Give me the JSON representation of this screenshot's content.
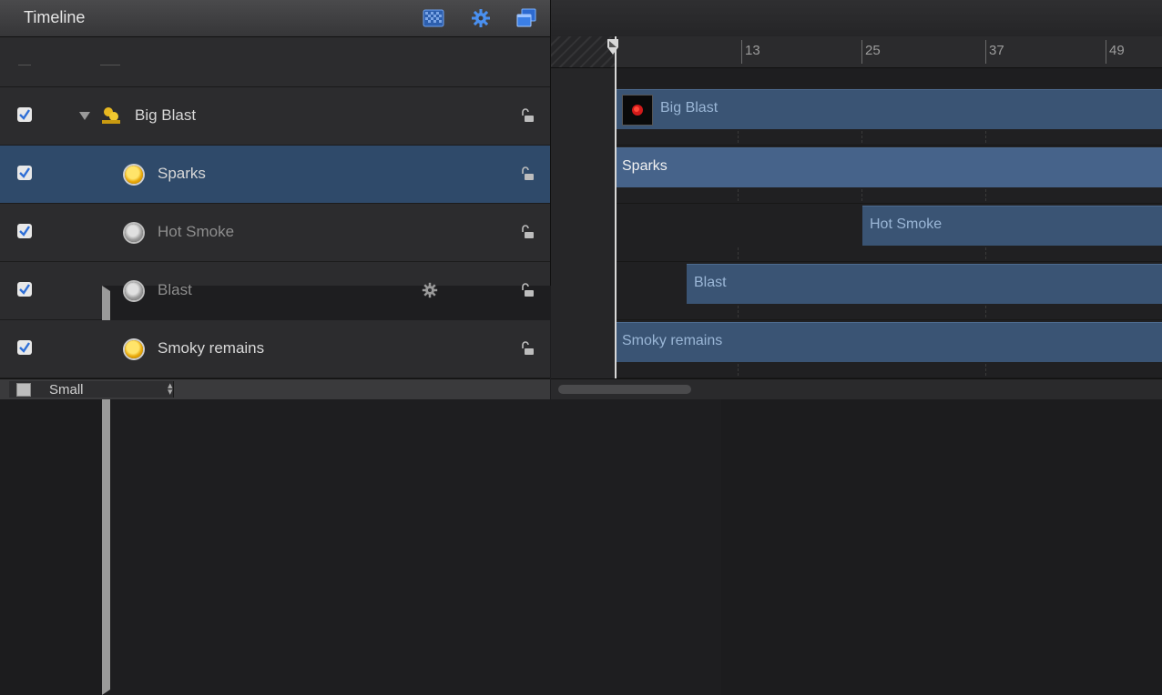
{
  "header": {
    "title": "Timeline",
    "icons": [
      "checker-grid-icon",
      "gear-icon",
      "stacked-windows-icon"
    ],
    "accent": "#3a7ee0"
  },
  "layers": [
    {
      "name": "Big Blast",
      "type": "group",
      "checked": true,
      "expanded": true,
      "dim": false,
      "selected": false
    },
    {
      "name": "Sparks",
      "type": "emitter",
      "checked": true,
      "dim": false,
      "selected": true
    },
    {
      "name": "Hot Smoke",
      "type": "emitter",
      "checked": true,
      "dim": true,
      "selected": false
    },
    {
      "name": "Blast",
      "type": "emitter",
      "checked": true,
      "collapsed": true,
      "dim": true,
      "selected": false
    },
    {
      "name": "Smoky remains",
      "type": "emitter",
      "checked": true,
      "dim": false,
      "selected": false
    }
  ],
  "bars": [
    {
      "label": "Big Blast"
    },
    {
      "label": "Sparks"
    },
    {
      "label": "Hot Smoke"
    },
    {
      "label": "Blast"
    },
    {
      "label": "Smoky remains"
    }
  ],
  "ruler": {
    "ticks": [
      "13",
      "25",
      "37",
      "49"
    ]
  },
  "footer": {
    "size_label": "Small"
  }
}
